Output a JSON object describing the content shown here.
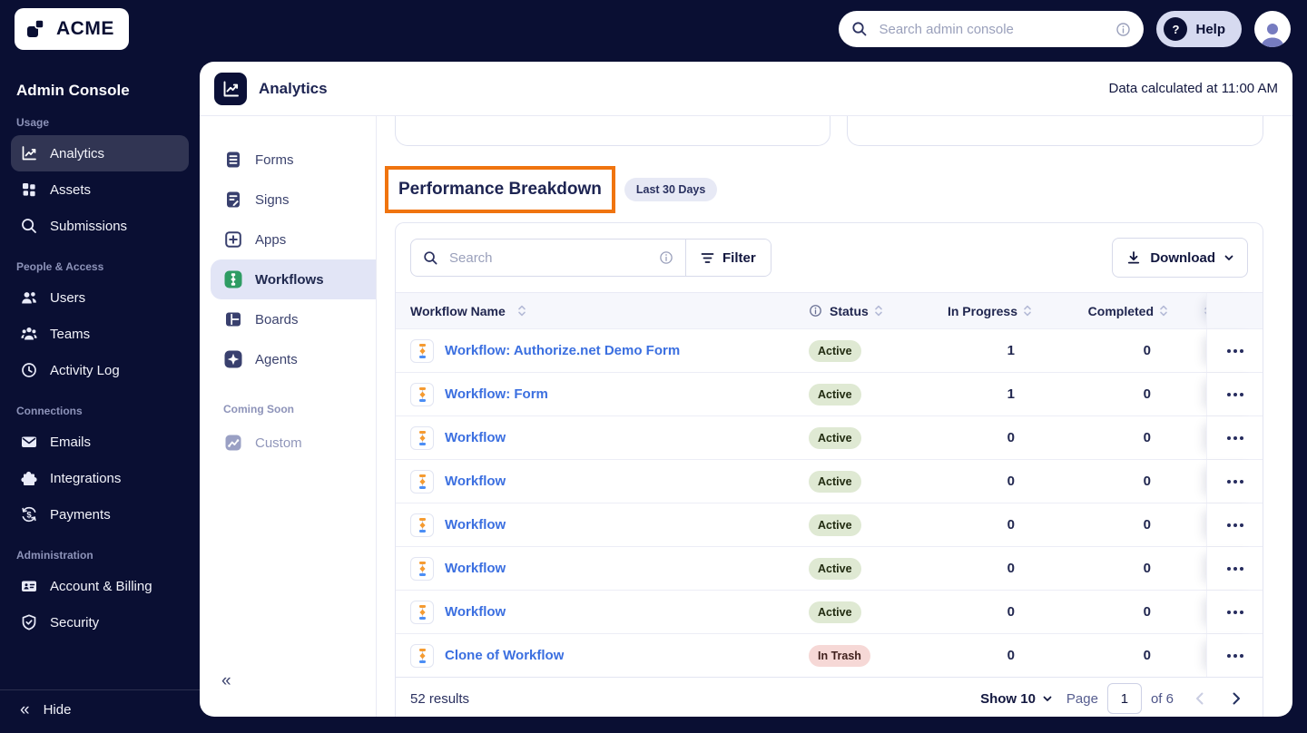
{
  "topbar": {
    "brand": "ACME",
    "search_placeholder": "Search admin console",
    "help_label": "Help"
  },
  "sidebar": {
    "title": "Admin Console",
    "sections": [
      {
        "label": "Usage",
        "items": [
          {
            "label": "Analytics",
            "active": true
          },
          {
            "label": "Assets"
          },
          {
            "label": "Submissions"
          }
        ]
      },
      {
        "label": "People & Access",
        "items": [
          {
            "label": "Users"
          },
          {
            "label": "Teams"
          },
          {
            "label": "Activity Log"
          }
        ]
      },
      {
        "label": "Connections",
        "items": [
          {
            "label": "Emails"
          },
          {
            "label": "Integrations"
          },
          {
            "label": "Payments"
          }
        ]
      },
      {
        "label": "Administration",
        "items": [
          {
            "label": "Account & Billing"
          },
          {
            "label": "Security"
          }
        ]
      }
    ],
    "hide_label": "Hide"
  },
  "panel": {
    "title": "Analytics",
    "calculated_text": "Data calculated at 11:00 AM",
    "nav": {
      "items": [
        {
          "label": "Forms"
        },
        {
          "label": "Signs"
        },
        {
          "label": "Apps"
        },
        {
          "label": "Workflows",
          "active": true
        },
        {
          "label": "Boards"
        },
        {
          "label": "Agents"
        }
      ],
      "coming_soon_label": "Coming Soon",
      "coming_soon_item": "Custom"
    },
    "section": {
      "title": "Performance Breakdown",
      "period_badge": "Last 30 Days"
    },
    "toolbar": {
      "search_placeholder": "Search",
      "filter_label": "Filter",
      "download_label": "Download"
    },
    "table": {
      "columns": {
        "name": "Workflow Name",
        "status": "Status",
        "in_progress": "In Progress",
        "completed": "Completed"
      },
      "rows": [
        {
          "name": "Workflow: Authorize.net Demo Form",
          "status": "Active",
          "status_type": "active",
          "in_progress": "1",
          "completed": "0"
        },
        {
          "name": "Workflow: Form",
          "status": "Active",
          "status_type": "active",
          "in_progress": "1",
          "completed": "0"
        },
        {
          "name": "Workflow",
          "status": "Active",
          "status_type": "active",
          "in_progress": "0",
          "completed": "0"
        },
        {
          "name": "Workflow",
          "status": "Active",
          "status_type": "active",
          "in_progress": "0",
          "completed": "0"
        },
        {
          "name": "Workflow",
          "status": "Active",
          "status_type": "active",
          "in_progress": "0",
          "completed": "0"
        },
        {
          "name": "Workflow",
          "status": "Active",
          "status_type": "active",
          "in_progress": "0",
          "completed": "0"
        },
        {
          "name": "Workflow",
          "status": "Active",
          "status_type": "active",
          "in_progress": "0",
          "completed": "0"
        },
        {
          "name": "Clone of Workflow",
          "status": "In Trash",
          "status_type": "trash",
          "in_progress": "0",
          "completed": "0"
        }
      ]
    },
    "pagination": {
      "results_text": "52 results",
      "show_text": "Show 10",
      "page_label": "Page",
      "page_value": "1",
      "of_text": "of 6"
    }
  },
  "colors": {
    "navy_bg": "#0a0f33",
    "annotation_orange": "#f0740f",
    "link_blue": "#3b6fe0",
    "badge_active_bg": "#dfe9d3",
    "badge_trash_bg": "#f6d8d6",
    "workflows_green": "#2e9c63",
    "table_header_bg": "#f6f7fc"
  }
}
